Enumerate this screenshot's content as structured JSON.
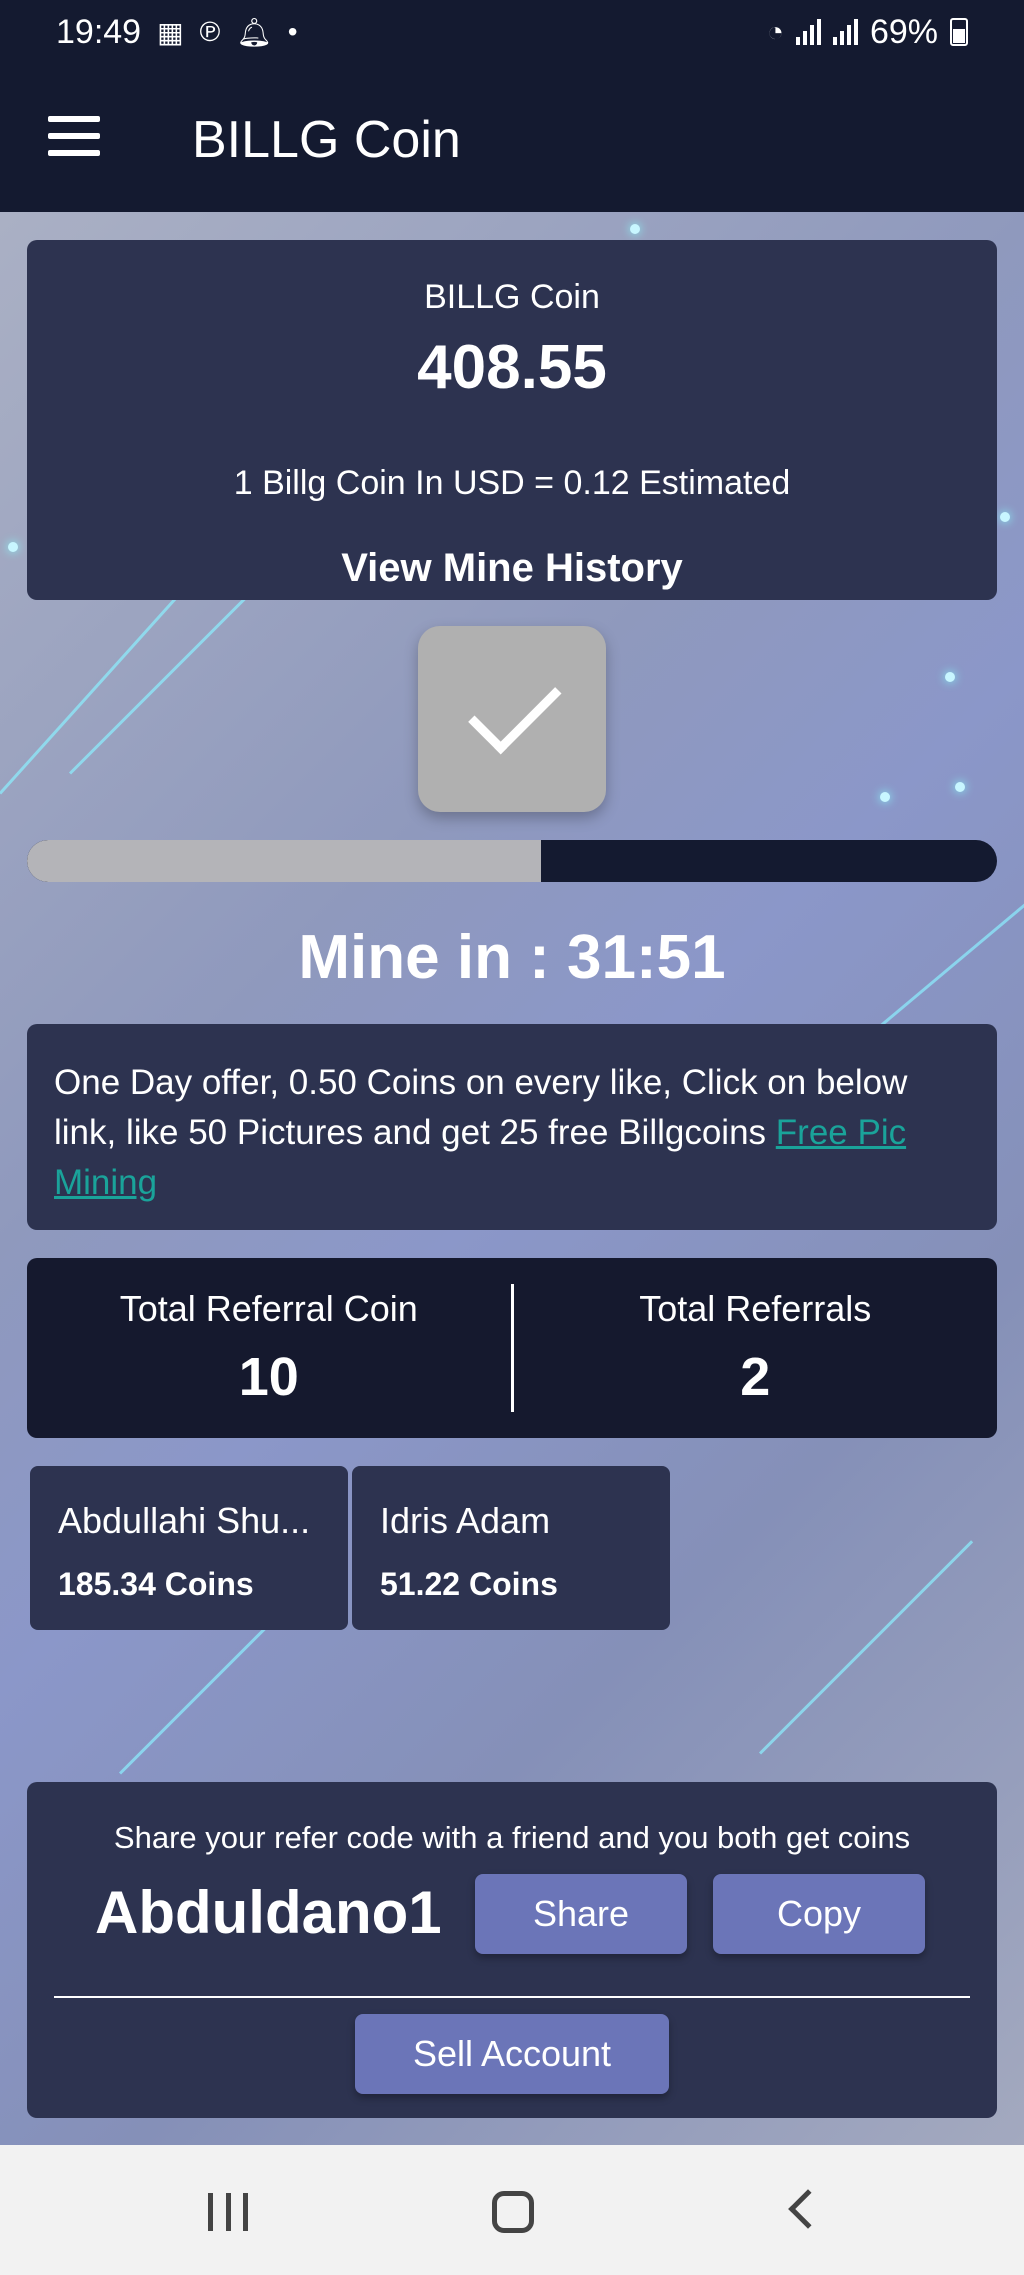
{
  "status_bar": {
    "time": "19:49",
    "battery": "69%",
    "icons": [
      "notification-icon",
      "picsart-icon",
      "bell-icon",
      "dot-icon",
      "wifi-icon",
      "signal-icon",
      "signal-icon",
      "battery-icon"
    ]
  },
  "app_bar": {
    "title": "BILLG Coin",
    "menu_icon": "hamburger-menu-icon"
  },
  "balance": {
    "title": "BILLG Coin",
    "amount": "408.55",
    "rate": "1 Billg Coin In USD = 0.12 Estimated",
    "history_label": "View Mine History"
  },
  "mining": {
    "check_icon": "checkmark-icon",
    "progress_fraction": 0.53,
    "timer_text": "Mine in : 31:51"
  },
  "offer": {
    "text": "One Day offer, 0.50 Coins on every like, Click on below link, like 50 Pictures and get 25 free Billgcoins ",
    "link_text": "Free Pic Mining "
  },
  "referral_stats": {
    "coin_label": "Total Referral Coin",
    "coin_value": "10",
    "count_label": "Total Referrals",
    "count_value": "2"
  },
  "referrals": [
    {
      "name": "Abdullahi Shu...",
      "coins": "185.34 Coins"
    },
    {
      "name": "Idris Adam",
      "coins": "51.22 Coins"
    }
  ],
  "share": {
    "text": "Share your refer code with a friend and you both get coins",
    "code": "Abduldano1",
    "share_label": "Share",
    "copy_label": "Copy",
    "sell_label": "Sell Account"
  },
  "colors": {
    "bar": "#141a30",
    "card": "#2d3350",
    "button": "#6b75b8",
    "link": "#1aa39a"
  }
}
